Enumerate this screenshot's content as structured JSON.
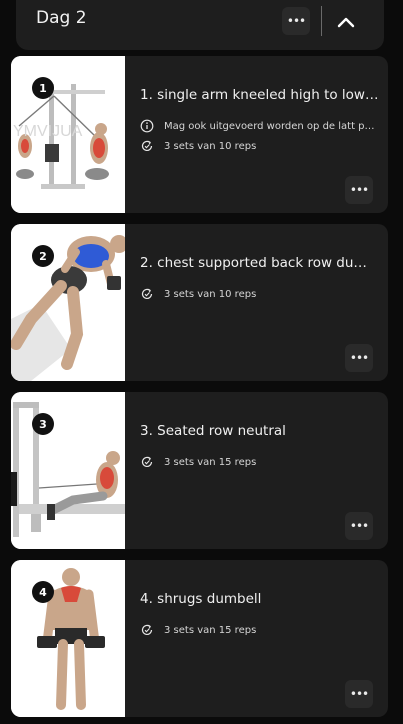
{
  "day": {
    "title": "Dag 2"
  },
  "exercises": [
    {
      "number": "1",
      "title": "1. single arm kneeled high to low ba...",
      "note": "Mag ook uitgevoerd worden op de latt pull...",
      "sets": "3 sets van 10 reps"
    },
    {
      "number": "2",
      "title": "2. chest supported back row dumbb...",
      "sets": "3 sets van 10 reps"
    },
    {
      "number": "3",
      "title": "3. Seated row neutral",
      "sets": "3 sets van 15 reps"
    },
    {
      "number": "4",
      "title": "4. shrugs dumbell",
      "sets": "3 sets van 15 reps"
    }
  ],
  "icons": {
    "options": "ellipsis-icon",
    "collapse": "chevron-up-icon",
    "info": "info-icon",
    "sets": "repeat-icon"
  },
  "colors": {
    "background": "#0b0b0b",
    "card": "#1e1e1e",
    "muscle_highlight_blue": "#2f5bd6",
    "muscle_highlight_red": "#d84a3a"
  }
}
